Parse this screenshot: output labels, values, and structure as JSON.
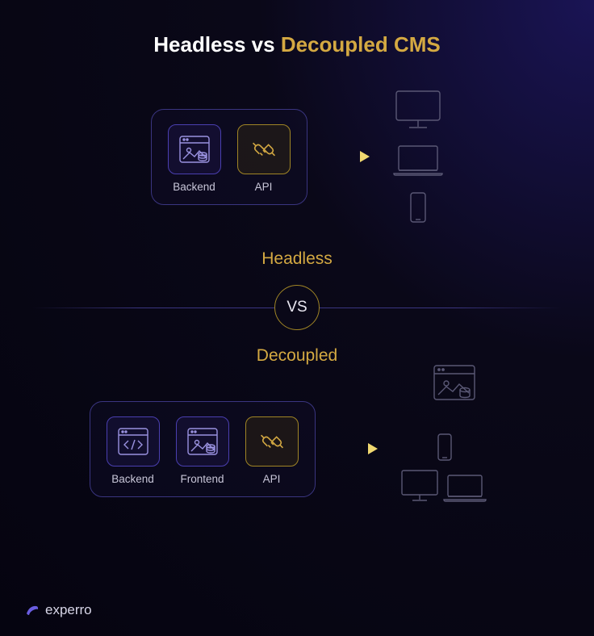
{
  "title": {
    "prefix": "Headless vs ",
    "accent": "Decoupled CMS"
  },
  "headless": {
    "label": "Headless",
    "nodes": {
      "backend": "Backend",
      "api": "API"
    }
  },
  "vs_label": "VS",
  "decoupled": {
    "label": "Decoupled",
    "nodes": {
      "backend": "Backend",
      "frontend": "Frontend",
      "api": "API"
    }
  },
  "brand": "experro",
  "colors": {
    "accent_gold": "#d4a942",
    "box_purple": "#4a3fb0",
    "box_gold": "#a08525"
  }
}
